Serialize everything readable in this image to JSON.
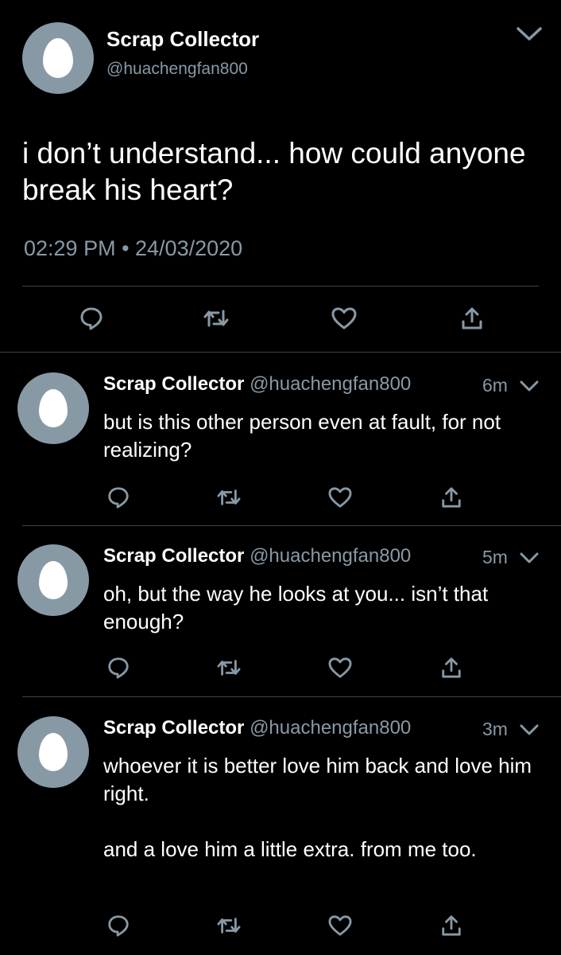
{
  "main_tweet": {
    "name": "Scrap Collector",
    "handle": "@huachengfan800",
    "text": "i don’t understand... how could anyone break his heart?",
    "timestamp": "02:29 PM • 24/03/2020"
  },
  "replies": [
    {
      "name": "Scrap Collector",
      "handle": "@huachengfan800",
      "time": "6m",
      "text": "but is this other person even at fault, for not realizing?"
    },
    {
      "name": "Scrap Collector",
      "handle": "@huachengfan800",
      "time": "5m",
      "text": "oh, but the way he looks at you... isn’t that enough?"
    },
    {
      "name": "Scrap Collector",
      "handle": "@huachengfan800",
      "time": "3m",
      "text": "whoever it is better love him back and love him right.\n\nand a love him a little extra. from me too."
    }
  ],
  "icons": {
    "reply": "reply-icon",
    "retweet": "retweet-icon",
    "like": "heart-icon",
    "share": "share-icon",
    "menu": "chevron-down-icon"
  },
  "colors": {
    "background": "#000000",
    "secondary_text": "#8899a6",
    "divider": "#38444d",
    "avatar_bg": "#8899a6"
  }
}
